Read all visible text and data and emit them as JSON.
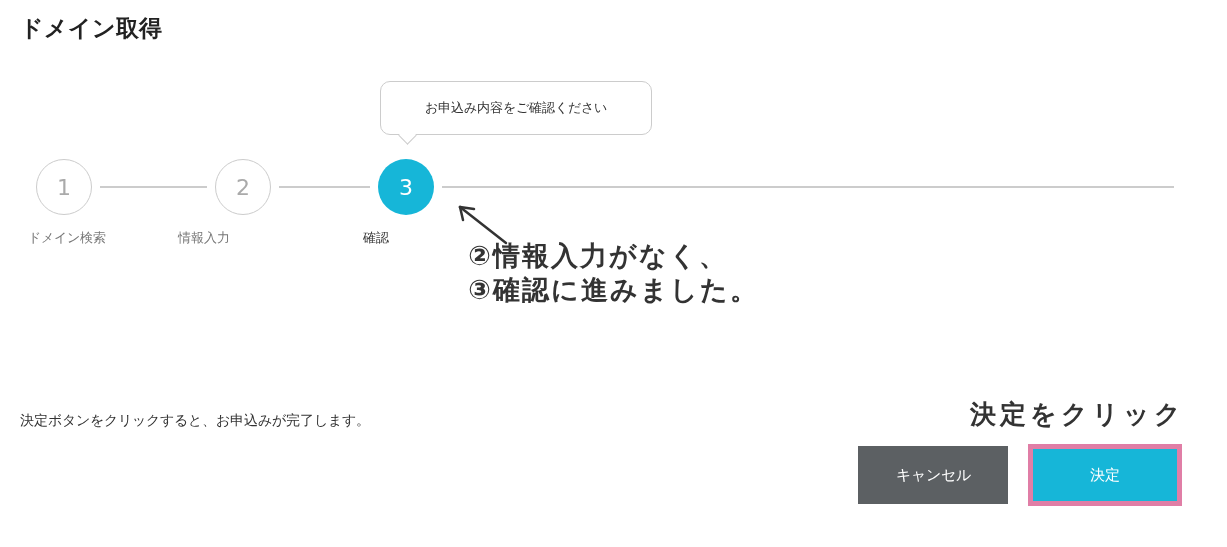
{
  "page_title": "ドメイン取得",
  "tooltip": "お申込み内容をご確認ください",
  "steps": [
    {
      "number": "1",
      "label": "ドメイン検索",
      "selected": false
    },
    {
      "number": "2",
      "label": "情報入力",
      "selected": false
    },
    {
      "number": "3",
      "label": "確認",
      "selected": true
    }
  ],
  "step_note": [
    "②情報入力がなく、",
    "③確認に進みました。"
  ],
  "message": "決定ボタンをクリックすると、お申込みが完了します。",
  "click_note": "決定をクリック",
  "buttons": [
    {
      "label": "キャンセル",
      "kind": "secondary",
      "highlighted": false
    },
    {
      "label": "決定",
      "kind": "primary",
      "highlighted": true
    }
  ]
}
